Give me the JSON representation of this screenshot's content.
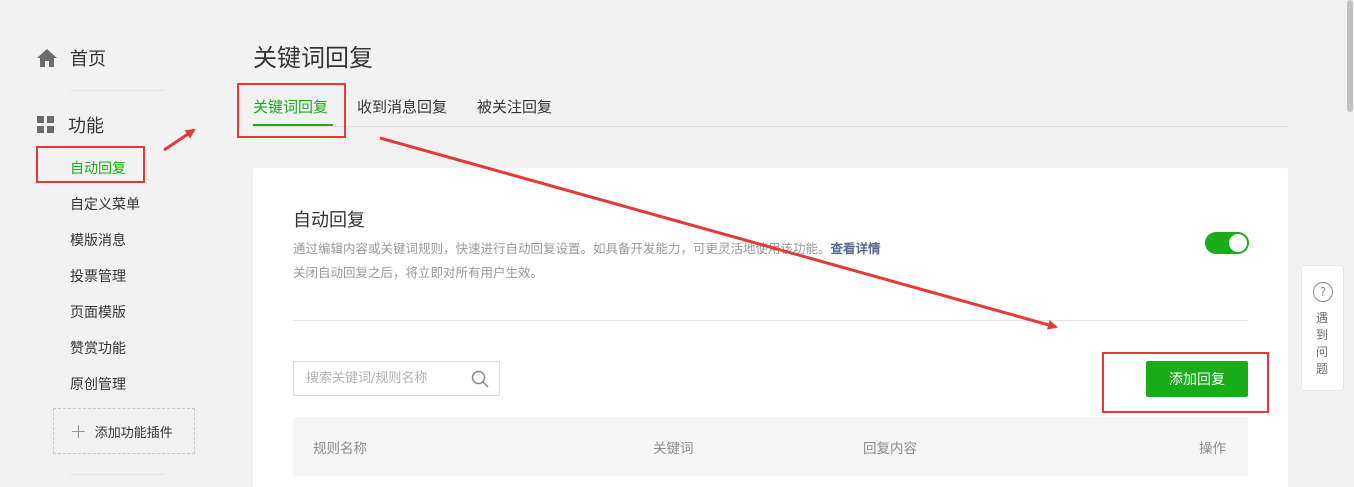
{
  "sidebar": {
    "home_label": "首页",
    "function_label": "功能",
    "items": [
      {
        "label": "自动回复",
        "active": true
      },
      {
        "label": "自定义菜单"
      },
      {
        "label": "模版消息"
      },
      {
        "label": "投票管理"
      },
      {
        "label": "页面模版"
      },
      {
        "label": "赞赏功能"
      },
      {
        "label": "原创管理"
      }
    ],
    "add_plugin_label": "添加功能插件"
  },
  "header": {
    "title": "关键词回复",
    "tabs": [
      {
        "label": "关键词回复",
        "active": true
      },
      {
        "label": "收到消息回复"
      },
      {
        "label": "被关注回复"
      }
    ]
  },
  "card": {
    "title": "自动回复",
    "desc_line1": "通过编辑内容或关键词规则，快速进行自动回复设置。如具备开发能力，可更灵活地使用该功能。",
    "desc_link": "查看详情",
    "desc_line2": "关闭自动回复之后，将立即对所有用户生效。",
    "toggle_on": true,
    "search_placeholder": "搜索关键词/规则名称",
    "add_button": "添加回复",
    "columns": [
      "规则名称",
      "关键词",
      "回复内容",
      "操作"
    ]
  },
  "help": {
    "icon_glyph": "?",
    "text": "遇到问题"
  },
  "colors": {
    "accent": "#1aad19",
    "link": "#576b95",
    "annotation": "#e53935"
  }
}
